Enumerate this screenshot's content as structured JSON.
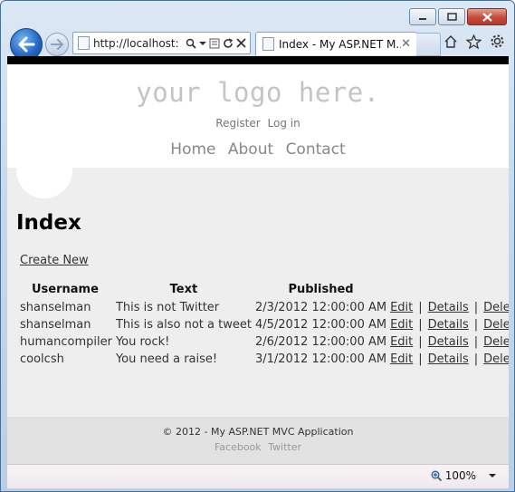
{
  "browser": {
    "address_url": "http://localhost:",
    "tab_title": "Index - My ASP.NET M...",
    "zoom_level": "100%"
  },
  "site": {
    "logo_text": "your logo here.",
    "login_links": [
      "Register",
      "Log in"
    ],
    "menu": [
      "Home",
      "About",
      "Contact"
    ]
  },
  "page": {
    "title": "Index",
    "create_link": "Create New",
    "columns": [
      "Username",
      "Text",
      "Published"
    ],
    "actions": [
      "Edit",
      "Details",
      "Delete"
    ],
    "rows": [
      {
        "username": "shanselman",
        "text": "This is not Twitter",
        "published": "2/3/2012 12:00:00 AM"
      },
      {
        "username": "shanselman",
        "text": "This is also not a tweet",
        "published": "4/5/2012 12:00:00 AM"
      },
      {
        "username": "humancompiler",
        "text": "You rock!",
        "published": "2/6/2012 12:00:00 AM"
      },
      {
        "username": "coolcsh",
        "text": "You need a raise!",
        "published": "3/1/2012 12:00:00 AM"
      }
    ]
  },
  "footer": {
    "copyright": "© 2012 - My ASP.NET MVC Application",
    "social": [
      "Facebook",
      "Twitter"
    ]
  }
}
